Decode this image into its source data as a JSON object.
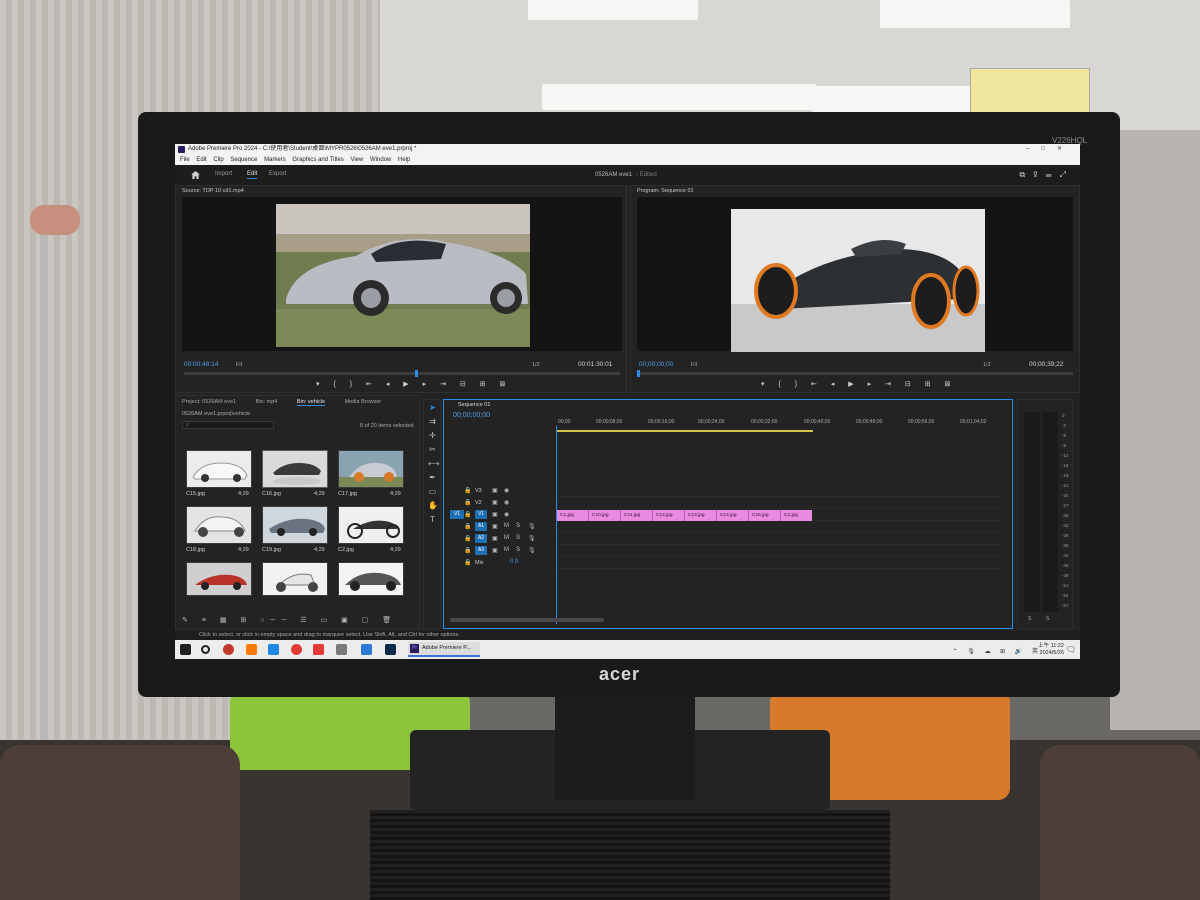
{
  "monitor": {
    "brand": "acer",
    "model": "V226HQL"
  },
  "app": {
    "title": "Adobe Premiere Pro 2024 - C:\\使用者\\Student\\桌面\\MYPR0526\\0526AM eve1.prproj *",
    "menu": [
      "File",
      "Edit",
      "Clip",
      "Sequence",
      "Markers",
      "Graphics and Titles",
      "View",
      "Window",
      "Help"
    ],
    "workspace_tabs": [
      "Import",
      "Edit",
      "Export"
    ],
    "active_tab": "Edit",
    "project_name": "0526AM eve1",
    "edited_label": "- Edited"
  },
  "source_monitor": {
    "header": "Source: TOP 10 cd1.mp4",
    "timecode_current": "00:00:48:14",
    "fit": "Fit",
    "resolution": "1/2",
    "timecode_duration": "00:01:30:01",
    "playhead_fraction": 0.53
  },
  "program_monitor": {
    "header": "Program: Sequence 01",
    "timecode_current": "00;00;00;00",
    "fit": "Fit",
    "resolution": "1/2",
    "timecode_duration": "00;00;39;22",
    "playhead_fraction": 0.0
  },
  "project_panel": {
    "tabs": [
      "Project: 0526AM eve1",
      "Bin: mp4",
      "Bin: vehicle",
      "Media Browser"
    ],
    "active_tab": "Bin: vehicle",
    "path": "0526AM eve1.prproj\\vehicle",
    "search_placeholder": "",
    "count": "8 of 20 items selected",
    "items": [
      {
        "name": "C15.jpg",
        "duration": "4;29"
      },
      {
        "name": "C16.jpg",
        "duration": "4;29"
      },
      {
        "name": "C17.jpg",
        "duration": "4;29"
      },
      {
        "name": "C18.jpg",
        "duration": "4;29"
      },
      {
        "name": "C19.jpg",
        "duration": "4;29"
      },
      {
        "name": "C2.jpg",
        "duration": "4;29"
      },
      {
        "name": "",
        "duration": ""
      },
      {
        "name": "",
        "duration": ""
      },
      {
        "name": "",
        "duration": ""
      }
    ]
  },
  "timeline": {
    "tab": "Sequence 01",
    "timecode": "00;00;00;00",
    "ruler": [
      "00;00",
      "00;00;08;00",
      "00;00;16;00",
      "00;00;24;00",
      "00;00;32;00",
      "00;00;40;00",
      "00;00;48;00",
      "00;00;56;00",
      "00;01;04;02"
    ],
    "video_tracks": [
      "V3",
      "V2",
      "V1"
    ],
    "audio_tracks": [
      "A1",
      "A2",
      "A3"
    ],
    "source_patch": "V1",
    "mix_label": "Mix",
    "mix_value": "0.0",
    "clips": [
      "C1.jpg",
      "C10.jpg",
      "C11.jpg",
      "C12.jpg",
      "C13.jpg",
      "C14.jpg",
      "C16.jpg",
      "C2.jpg"
    ]
  },
  "meter": {
    "scale": [
      "0",
      "-3",
      "-6",
      "-9",
      "-12",
      "-15",
      "-18",
      "-21",
      "-24",
      "-27",
      "-30",
      "-33",
      "-36",
      "-39",
      "-42",
      "-45",
      "-48",
      "-51",
      "-54",
      "-57"
    ],
    "channels": [
      "S",
      "S"
    ]
  },
  "status_bar": "Click to select, or click in empty space and drag to marquee select. Use Shift, Alt, and Ctrl for other options.",
  "taskbar": {
    "app_label": "Adobe Premiere P...",
    "time": "上午 11:22",
    "date": "2024/5/26"
  },
  "colors": {
    "accent": "#2d8ceb",
    "clip": "#e78ae0",
    "timecode": "#4f9fe6"
  }
}
